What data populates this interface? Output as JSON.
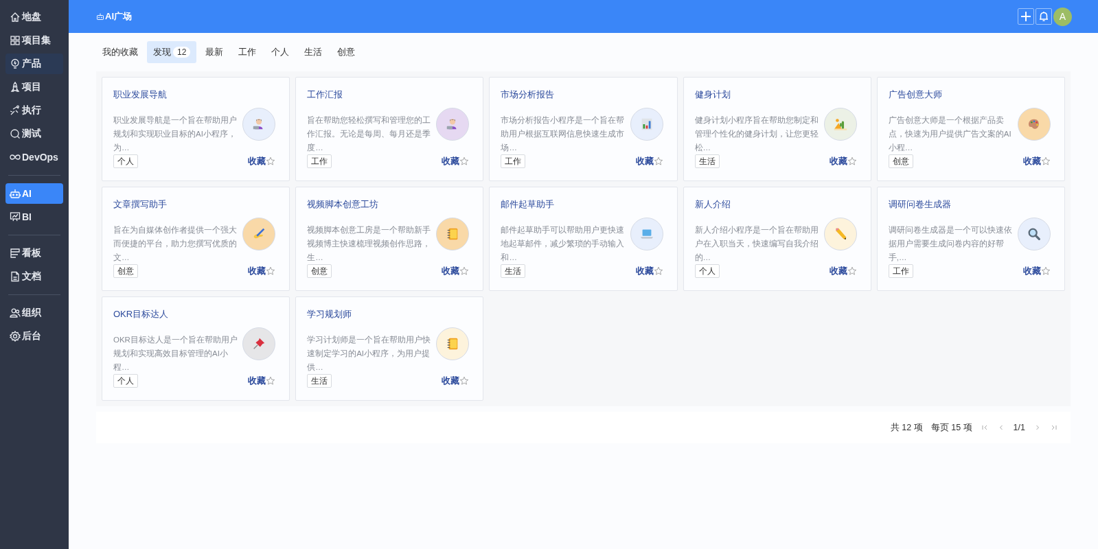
{
  "sidebar": {
    "groups": [
      [
        {
          "label": "地盘",
          "kind": "home",
          "selected": false,
          "highlighted": false
        },
        {
          "label": "项目集",
          "kind": "grid",
          "selected": false,
          "highlighted": false
        },
        {
          "label": "产品",
          "kind": "bulb",
          "selected": false,
          "highlighted": true
        },
        {
          "label": "项目",
          "kind": "rocket",
          "selected": false,
          "highlighted": false
        },
        {
          "label": "执行",
          "kind": "run",
          "selected": false,
          "highlighted": false
        },
        {
          "label": "测试",
          "kind": "search",
          "selected": false,
          "highlighted": false
        },
        {
          "label": "DevOps",
          "kind": "infinity",
          "selected": false,
          "highlighted": false
        }
      ],
      [
        {
          "label": "AI",
          "kind": "robot",
          "selected": true,
          "highlighted": false
        },
        {
          "label": "BI",
          "kind": "board",
          "selected": false,
          "highlighted": false
        }
      ],
      [
        {
          "label": "看板",
          "kind": "kanban",
          "selected": false,
          "highlighted": false
        },
        {
          "label": "文档",
          "kind": "doc",
          "selected": false,
          "highlighted": false
        }
      ],
      [
        {
          "label": "组织",
          "kind": "people",
          "selected": false,
          "highlighted": false
        },
        {
          "label": "后台",
          "kind": "gear",
          "selected": false,
          "highlighted": false
        }
      ]
    ]
  },
  "header": {
    "title": "AI广场",
    "avatar": "A"
  },
  "tabs": [
    {
      "label": "我的收藏",
      "selected": false
    },
    {
      "label": "发现",
      "count": "12",
      "selected": true
    },
    {
      "label": "最新",
      "selected": false
    },
    {
      "label": "工作",
      "selected": false
    },
    {
      "label": "个人",
      "selected": false
    },
    {
      "label": "生活",
      "selected": false
    },
    {
      "label": "创意",
      "selected": false
    }
  ],
  "cards": [
    {
      "title": "职业发展导航",
      "desc": "职业发展导航是一个旨在帮助用户规划和实现职业目标的AI小程序，为…",
      "tag": "个人",
      "action": "收藏",
      "kind": "person",
      "color": "#e8effc"
    },
    {
      "title": "工作汇报",
      "desc": "旨在帮助您轻松撰写和管理您的工作汇报。无论是每周、每月还是季度…",
      "tag": "工作",
      "action": "收藏",
      "kind": "person",
      "color": "#e6d9f2"
    },
    {
      "title": "市场分析报告",
      "desc": "市场分析报告小程序是一个旨在帮助用户根据互联网信息快速生成市场…",
      "tag": "工作",
      "action": "收藏",
      "kind": "chart",
      "color": "#e8effc"
    },
    {
      "title": "健身计划",
      "desc": "健身计划小程序旨在帮助您制定和管理个性化的健身计划，让您更轻松…",
      "tag": "生活",
      "action": "收藏",
      "kind": "cactus",
      "color": "#ecf1e6"
    },
    {
      "title": "广告创意大师",
      "desc": "广告创意大师是一个根据产品卖点，快速为用户提供广告文案的AI小程…",
      "tag": "创意",
      "action": "收藏",
      "kind": "palette",
      "color": "#f9d9a8"
    },
    {
      "title": "文章撰写助手",
      "desc": "旨在为自媒体创作者提供一个强大而便捷的平台，助力您撰写优质的文…",
      "tag": "创意",
      "action": "收藏",
      "kind": "hand",
      "color": "#f9d9a8"
    },
    {
      "title": "视频脚本创意工坊",
      "desc": "视频脚本创意工房是一个帮助新手视频博主快速梳理视频创作思路，生…",
      "tag": "创意",
      "action": "收藏",
      "kind": "notebook",
      "color": "#f9d9a8"
    },
    {
      "title": "邮件起草助手",
      "desc": "邮件起草助手可以帮助用户更快速地起草邮件，减少繁琐的手动输入和…",
      "tag": "生活",
      "action": "收藏",
      "kind": "laptop",
      "color": "#e8effc"
    },
    {
      "title": "新人介绍",
      "desc": "新人介绍小程序是一个旨在帮助用户在入职当天，快速编写自我介绍的…",
      "tag": "个人",
      "action": "收藏",
      "kind": "pencil",
      "color": "#fdf3dc"
    },
    {
      "title": "调研问卷生成器",
      "desc": "调研问卷生成器是一个可以快速依据用户需要生成问卷内容的好帮手,…",
      "tag": "工作",
      "action": "收藏",
      "kind": "magnifier",
      "color": "#e8effc"
    },
    {
      "title": "OKR目标达人",
      "desc": "OKR目标达人是一个旨在帮助用户规划和实现高效目标管理的AI小程…",
      "tag": "个人",
      "action": "收藏",
      "kind": "pin",
      "color": "#e6e6e8"
    },
    {
      "title": "学习规划师",
      "desc": "学习计划师是一个旨在帮助用户快速制定学习的AI小程序，为用户提供…",
      "tag": "生活",
      "action": "收藏",
      "kind": "notebook",
      "color": "#fdf3dc"
    }
  ],
  "pagination": {
    "total": "共 12 项",
    "per_page": "每页 15 项",
    "page": "1/1",
    "first_disabled": true,
    "prev_disabled": true,
    "next_disabled": true,
    "last_disabled": true
  }
}
